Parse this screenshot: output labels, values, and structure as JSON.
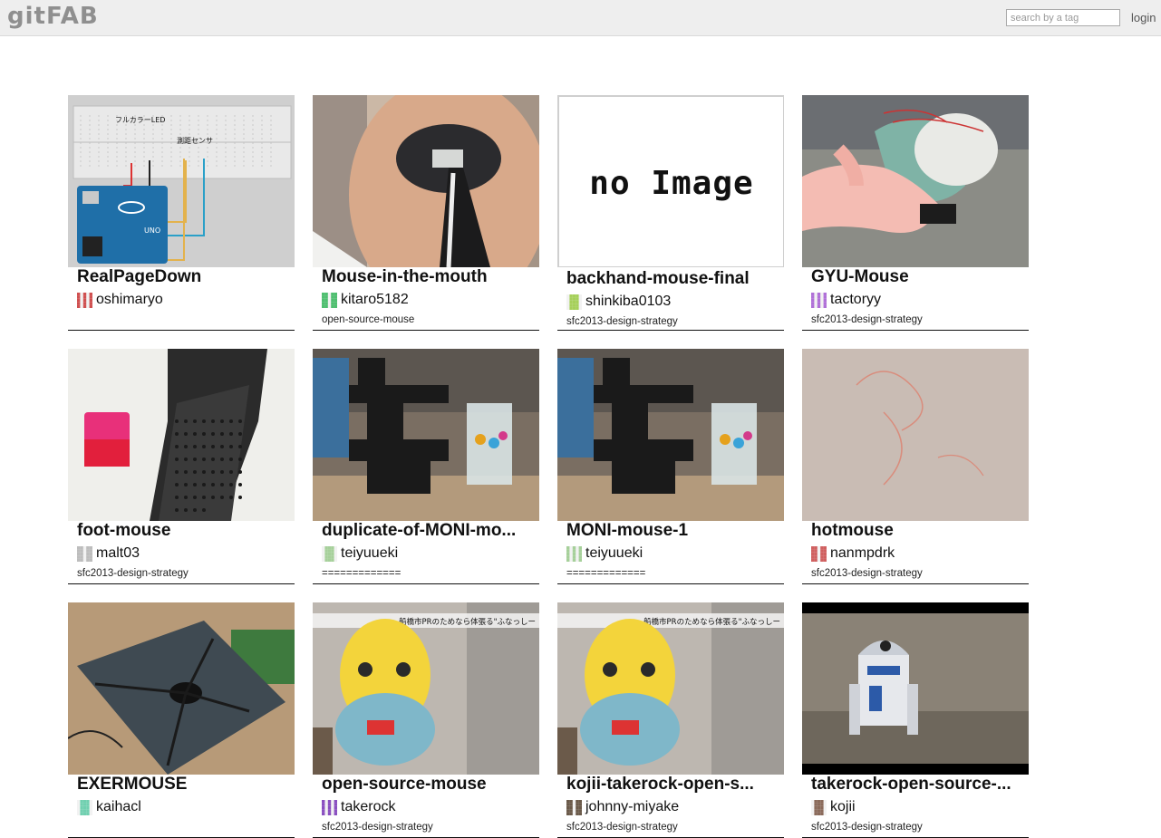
{
  "header": {
    "logo": "gitFAB",
    "search_placeholder": "search by a tag",
    "login_label": "login"
  },
  "projects": [
    {
      "title": "RealPageDown",
      "owner": "oshimaryo",
      "tag": "",
      "thumb": "breadboard-circuit",
      "thumb_text": [
        "フルカラーLED",
        "測距センサ"
      ],
      "avatar_color": "#d05050"
    },
    {
      "title": "Mouse-in-the-mouth",
      "owner": "kitaro5182",
      "tag": "open-source-mouse",
      "thumb": "mouth-photo",
      "avatar_color": "#4fbf70"
    },
    {
      "title": "backhand-mouse-final",
      "owner": "shinkiba0103",
      "tag": "sfc2013-design-strategy",
      "thumb": "no-image",
      "thumb_text": [
        "no Image"
      ],
      "avatar_color": "#a6d05a"
    },
    {
      "title": "GYU-Mouse",
      "owner": "tactoryy",
      "tag": "sfc2013-design-strategy",
      "thumb": "glove-mouse-photo",
      "avatar_color": "#b070d8"
    },
    {
      "title": "foot-mouse",
      "owner": "malt03",
      "tag": "sfc2013-design-strategy",
      "thumb": "sandal-photo",
      "avatar_color": "#bdbdbd"
    },
    {
      "title": "duplicate-of-MONI-mo...",
      "owner": "teiyuueki",
      "tag": "=============",
      "thumb": "blocks-photo",
      "avatar_color": "#a6d09a"
    },
    {
      "title": "MONI-mouse-1",
      "owner": "teiyuueki",
      "tag": "=============",
      "thumb": "blocks-photo",
      "avatar_color": "#a6d09a"
    },
    {
      "title": "hotmouse",
      "owner": "nanmpdrk",
      "tag": "sfc2013-design-strategy",
      "thumb": "fabric-photo",
      "avatar_color": "#d06060"
    },
    {
      "title": "EXERMOUSE",
      "owner": "kaihacl",
      "tag": "",
      "thumb": "workbench-photo",
      "avatar_color": "#70d0b0"
    },
    {
      "title": "open-source-mouse",
      "owner": "takerock",
      "tag": "sfc2013-design-strategy",
      "thumb": "mascot-photo",
      "thumb_text": [
        "船橋市PRのためなら体張る\"ふなっしー"
      ],
      "avatar_color": "#8a4fc0"
    },
    {
      "title": "kojii-takerock-open-s...",
      "owner": "johnny-miyake",
      "tag": "sfc2013-design-strategy",
      "thumb": "mascot-photo",
      "thumb_text": [
        "船橋市PRのためなら体張る\"ふなっしー"
      ],
      "avatar_color": "#6b5a4a"
    },
    {
      "title": "takerock-open-source-...",
      "owner": "kojii",
      "tag": "sfc2013-design-strategy",
      "thumb": "robot-photo",
      "avatar_color": "#8a6a5a"
    }
  ]
}
